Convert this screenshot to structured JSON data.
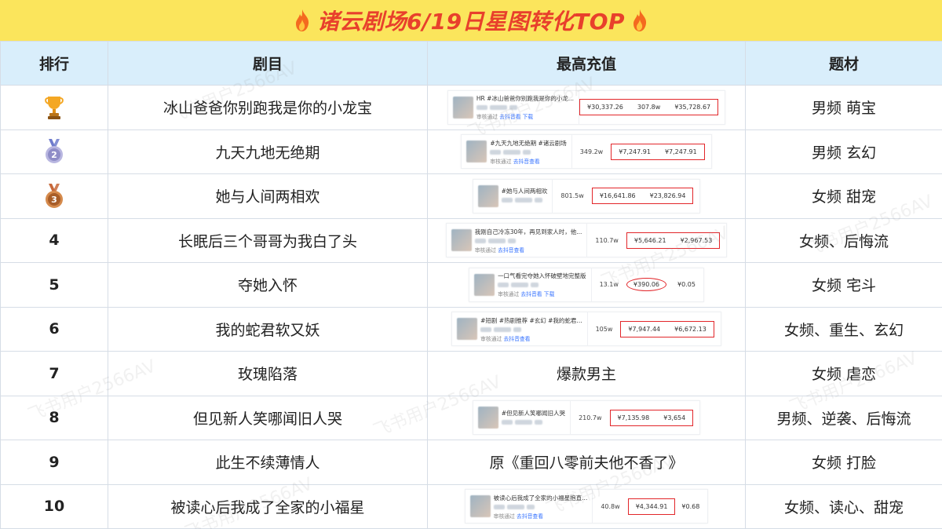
{
  "banner": {
    "title": "诸云剧场6/19日星图转化TOP",
    "left_icon": "fire-icon",
    "right_icon": "fire-icon"
  },
  "headers": [
    "排行",
    "剧目",
    "最高充值",
    "题材"
  ],
  "watermark": "飞书用户2566AV",
  "colors": {
    "banner_bg": "#fbe55c",
    "title": "#e8402c",
    "header_bg": "#d9eefb",
    "highlight": "#e2262a",
    "link": "#3370ff"
  },
  "rows": [
    {
      "rank": "",
      "medal": "trophy-icon",
      "title": "冰山爸爸你别跑我是你的小龙宝",
      "genre": "男频 萌宝",
      "topup": {
        "kind": "shot",
        "tags": "HR #冰山爸爸你别跑我是你的小龙...",
        "meta_status": "审核通过",
        "meta_link1": "去抖音看",
        "meta_link2": "下载",
        "boxed": [
          "¥30,337.26",
          "307.8w",
          "¥35,728.67"
        ],
        "plays": ""
      }
    },
    {
      "rank": "",
      "medal": "silver-medal-icon",
      "medal_number": "2",
      "title": "九天九地无绝期",
      "genre": "男频 玄幻",
      "topup": {
        "kind": "shot",
        "tags": "#九天九地无绝期 #诸云剧场",
        "meta_status": "审核通过",
        "meta_link1": "去抖音查看",
        "meta_link2": "",
        "plays": "349.2w",
        "boxed": [
          "¥7,247.91",
          "¥7,247.91"
        ]
      }
    },
    {
      "rank": "",
      "medal": "bronze-medal-icon",
      "medal_number": "3",
      "title": "她与人间两相欢",
      "genre": "女频 甜宠",
      "topup": {
        "kind": "shot",
        "tags": "#她与人间两相欢",
        "meta_status": "",
        "meta_link1": "",
        "meta_link2": "",
        "plays": "801.5w",
        "boxed": [
          "¥16,641.86",
          "¥23,826.94"
        ]
      }
    },
    {
      "rank": "4",
      "medal": "",
      "title": "长眠后三个哥哥为我白了头",
      "genre": "女频、后悔流",
      "topup": {
        "kind": "shot",
        "tags": "我刚自己冷冻30年，再见到家人时，他...",
        "meta_status": "审核通过",
        "meta_link1": "去抖音查看",
        "meta_link2": "",
        "plays": "110.7w",
        "boxed": [
          "¥5,646.21",
          "¥2,967.53"
        ]
      }
    },
    {
      "rank": "5",
      "medal": "",
      "title": "夺她入怀",
      "genre": "女频 宅斗",
      "topup": {
        "kind": "oval",
        "tags": "一口气看完夺她入怀破壁地完整版",
        "meta_status": "审核通过",
        "meta_link1": "去抖音看",
        "meta_link2": "下载",
        "plays": "13.1w",
        "oval": "¥390.06",
        "plain": "¥0.05"
      }
    },
    {
      "rank": "6",
      "medal": "",
      "title": "我的蛇君软又妖",
      "genre": "女频、重生、玄幻",
      "topup": {
        "kind": "shot",
        "tags": "#短剧 #热剧推荐 #玄幻 #我的蛇君...",
        "meta_status": "审核通过",
        "meta_link1": "去抖音查看",
        "meta_link2": "",
        "plays": "105w",
        "boxed": [
          "¥7,947.44",
          "¥6,672.13"
        ]
      }
    },
    {
      "rank": "7",
      "medal": "",
      "title": "玫瑰陷落",
      "genre": "女频 虐恋",
      "topup": {
        "kind": "text",
        "text": "爆款男主"
      }
    },
    {
      "rank": "8",
      "medal": "",
      "title": "但见新人笑哪闻旧人哭",
      "genre": "男频、逆袭、后悔流",
      "topup": {
        "kind": "shot",
        "tags": "#但见新人笑哪闻旧人哭",
        "meta_status": "",
        "meta_link1": "",
        "meta_link2": "",
        "plays": "210.7w",
        "boxed": [
          "¥7,135.98",
          "¥3,654"
        ]
      }
    },
    {
      "rank": "9",
      "medal": "",
      "title": "此生不续薄情人",
      "genre": "女频 打脸",
      "topup": {
        "kind": "text",
        "text": "原《重回八零前夫他不香了》"
      }
    },
    {
      "rank": "10",
      "medal": "",
      "title": "被读心后我成了全家的小福星",
      "genre": "女频、读心、甜宠",
      "topup": {
        "kind": "plainbox",
        "tags": "被读心后我成了全家的小福星抱直...",
        "meta_status": "审核通过",
        "meta_link1": "去抖音查看",
        "meta_link2": "",
        "plays": "40.8w",
        "boxed": [
          "¥4,344.91"
        ],
        "plain": "¥0.68"
      }
    }
  ]
}
